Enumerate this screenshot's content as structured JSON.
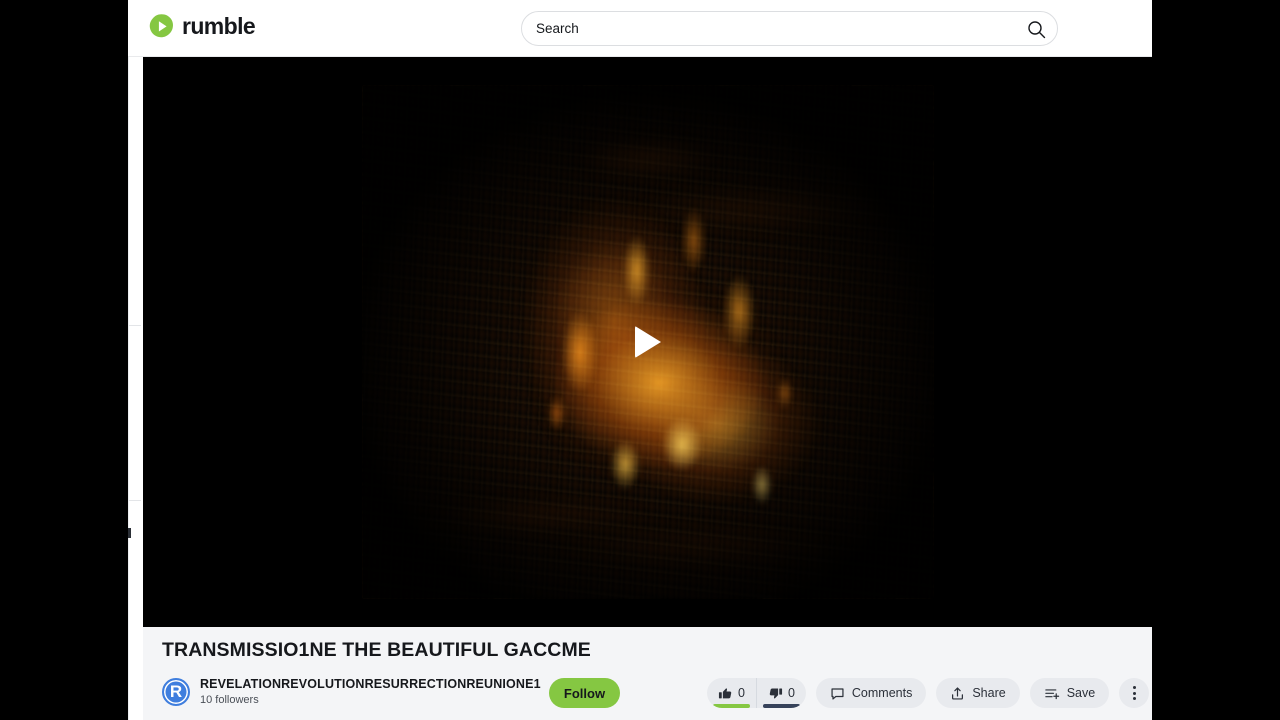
{
  "header": {
    "brand": "rumble",
    "logo_icon": "rumble-play-logo-icon",
    "brand_color": "#85c742",
    "search": {
      "placeholder": "Search",
      "value": "",
      "icon": "search-icon"
    }
  },
  "sidebar": {
    "state": "collapsed-partial",
    "items": []
  },
  "player": {
    "play_icon": "play-triangle-icon",
    "poster_description": "fire flames on black background",
    "background_color": "#000000"
  },
  "video": {
    "title": "TRANSMISSIO1NE THE BEAUTIFUL GACCME",
    "channel": {
      "avatar_letter": "R",
      "avatar_color": "#3f7ede",
      "name": "REVELATIONREVOLUTIONRESURRECTIONREUNIONE1",
      "followers": "10 followers"
    },
    "follow_button": {
      "label": "Follow",
      "color": "#85c742"
    },
    "actions": {
      "like": {
        "icon": "thumbs-up-icon",
        "count": "0",
        "bar_color": "#85c742"
      },
      "dislike": {
        "icon": "thumbs-down-icon",
        "count": "0",
        "bar_color": "#36425a"
      },
      "comments": {
        "icon": "comment-bubble-icon",
        "label": "Comments"
      },
      "share": {
        "icon": "share-upload-icon",
        "label": "Share"
      },
      "save": {
        "icon": "playlist-add-icon",
        "label": "Save"
      },
      "more": {
        "icon": "more-vertical-icon",
        "label": ""
      }
    }
  }
}
